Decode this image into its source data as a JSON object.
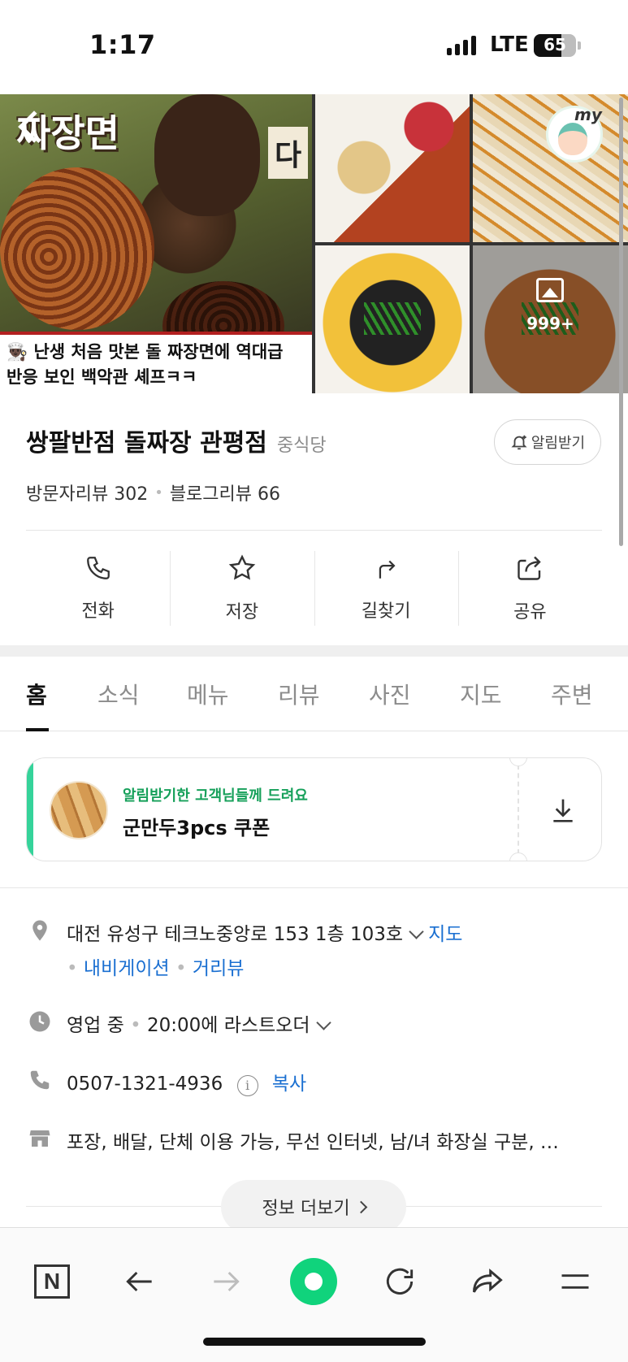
{
  "status_bar": {
    "time": "1:17",
    "network": "LTE",
    "battery": "65",
    "battery_level": 0.65
  },
  "gallery": {
    "video_overlay_title": "짜장면",
    "video_overlay_side": "다",
    "video_caption_line1": "👨🏿‍🍳 난생 처음 맛본 돌 짜장면에 역대급",
    "video_caption_line2": "반응 보인 백악관 셰프ㅋㅋ",
    "thumb1_label": "",
    "photo_count": "999+",
    "my_badge": "my"
  },
  "place": {
    "name": "쌍팔반점 돌짜장 관평점",
    "category": "중식당",
    "notify_label": "알림받기",
    "visitor_reviews": "방문자리뷰 302",
    "blog_reviews": "블로그리뷰 66"
  },
  "actions": [
    {
      "label": "전화",
      "icon": "phone-icon"
    },
    {
      "label": "저장",
      "icon": "star-icon"
    },
    {
      "label": "길찾기",
      "icon": "directions-icon"
    },
    {
      "label": "공유",
      "icon": "share-icon"
    }
  ],
  "tabs": [
    "홈",
    "소식",
    "메뉴",
    "리뷰",
    "사진",
    "지도",
    "주변"
  ],
  "coupon": {
    "subtitle": "알림받기한 고객님들께 드려요",
    "title": "군만두3pcs 쿠폰"
  },
  "info": {
    "address": "대전 유성구 테크노중앙로 153 1층 103호",
    "map_link": "지도",
    "navigation_link": "내비게이션",
    "street_view_link": "거리뷰",
    "hours_status": "영업 중",
    "hours_detail": "20:00에 라스트오더",
    "phone": "0507-1321-4936",
    "copy_link": "복사",
    "amenities": "포장, 배달, 단체 이용 가능, 무선 인터넷, 남/녀 화장실 구분, …",
    "more_label": "정보 더보기"
  },
  "colors": {
    "accent_green": "#10d37c",
    "link_blue": "#1a6fd1",
    "coupon_green": "#16a05a"
  }
}
